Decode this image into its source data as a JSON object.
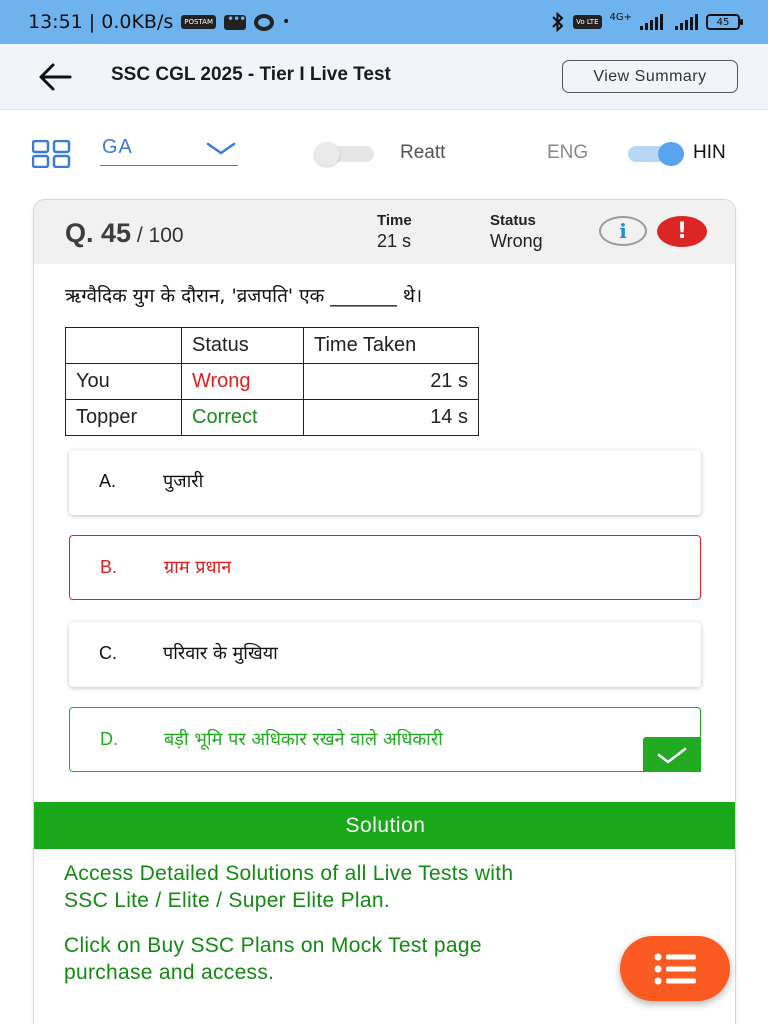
{
  "status_bar": {
    "time_speed": "13:51 | 0.0KB/s",
    "app_icon_text": "POSTAM",
    "network": "4G+",
    "volte": "Vo LTE",
    "battery": "45"
  },
  "header": {
    "title": "SSC CGL 2025 - Tier I Live Test",
    "view_summary": "View Summary"
  },
  "filters": {
    "section": "GA",
    "reattempt_label": "Reatt",
    "reattempt_on": false,
    "lang_left": "ENG",
    "lang_right": "HIN",
    "lang_selected": "HIN"
  },
  "question": {
    "number": "Q. 45",
    "total": " / 100",
    "time_label": "Time",
    "time_value": "21 s",
    "status_label": "Status",
    "status_value": "Wrong",
    "info_icon_glyph": "i",
    "alert_icon_glyph": "!",
    "text": "ऋग्वैदिक युग के दौरान, 'व्रजपति' एक _______ थे।"
  },
  "stats_table": {
    "headers": [
      "",
      "Status",
      "Time Taken"
    ],
    "rows": [
      {
        "who": "You",
        "status": "Wrong",
        "time": "21 s"
      },
      {
        "who": "Topper",
        "status": "Correct",
        "time": "14 s"
      }
    ]
  },
  "options": [
    {
      "letter": "A.",
      "text": "पुजारी",
      "state": "neutral"
    },
    {
      "letter": "B.",
      "text": "ग्राम प्रधान",
      "state": "selected-wrong"
    },
    {
      "letter": "C.",
      "text": "परिवार के मुखिया",
      "state": "neutral"
    },
    {
      "letter": "D.",
      "text": "बड़ी भूमि पर अधिकार रखने वाले अधिकारी",
      "state": "correct"
    }
  ],
  "solution": {
    "heading": "Solution",
    "line1": "Access Detailed Solutions of all Live Tests with",
    "line2": "SSC Lite / Elite / Super Elite Plan.",
    "line3": "Click on Buy SSC Plans on Mock Test page",
    "line4": "purchase and access."
  },
  "colors": {
    "wrong": "#e02020",
    "correct": "#1eae1e",
    "accent": "#3b7bd8",
    "solution_bar": "#18a818",
    "fab": "#fb5a22"
  }
}
